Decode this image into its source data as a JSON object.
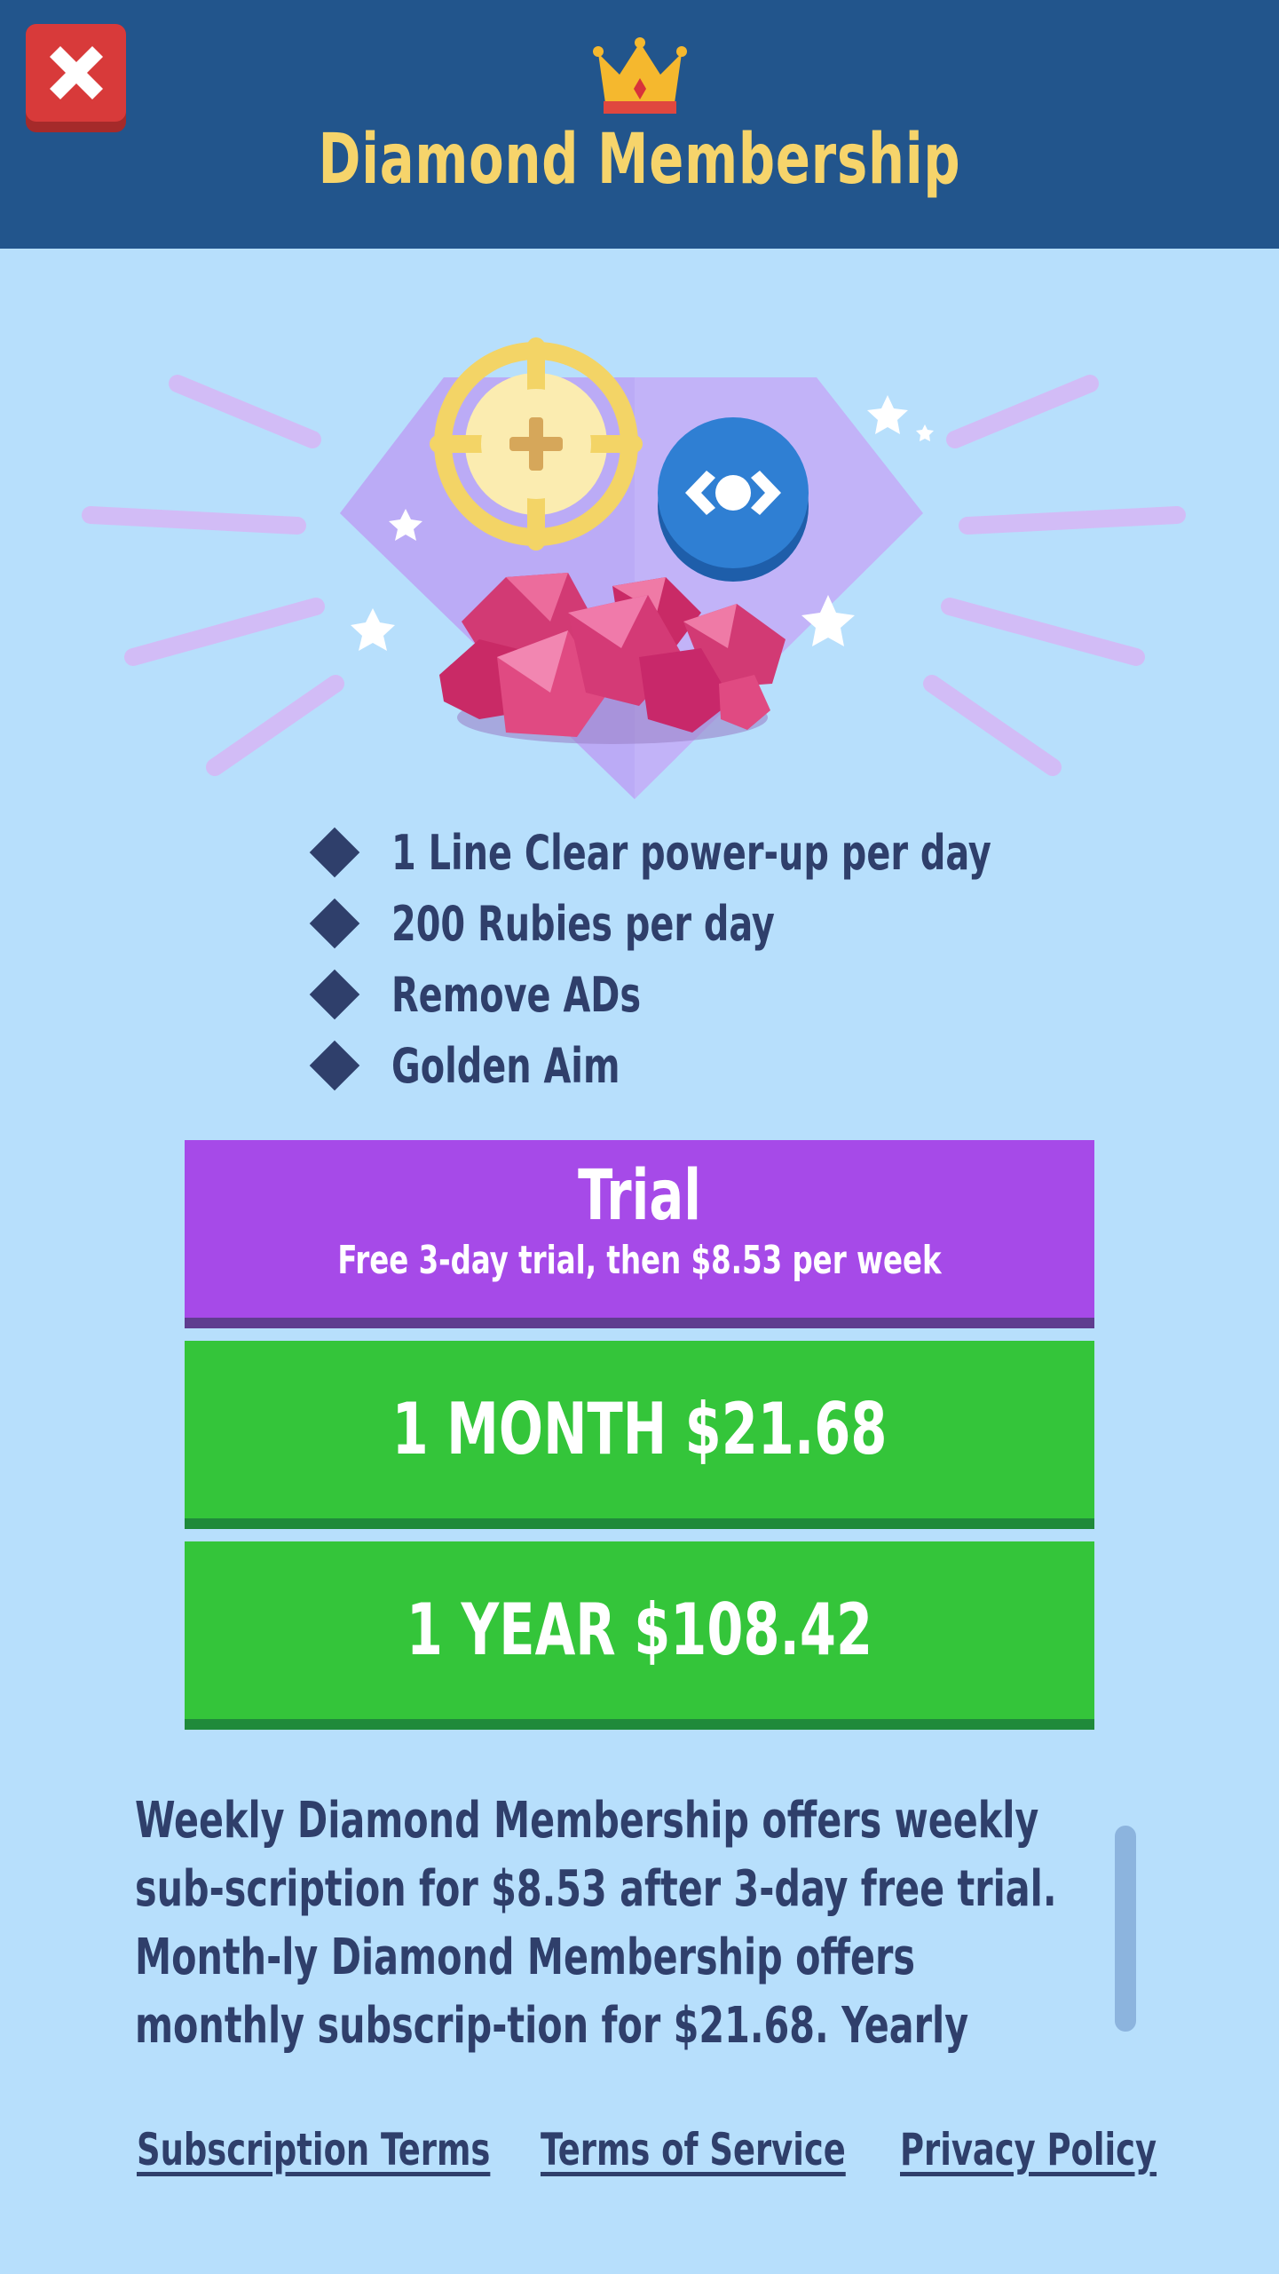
{
  "header": {
    "title": "Diamond Membership",
    "close_icon": "close-x-icon",
    "crown_icon": "crown-icon"
  },
  "hero": {
    "icons": [
      "golden-aim-icon",
      "line-clear-icon",
      "rubies-icon",
      "diamond-icon",
      "sparkle-star-icon"
    ]
  },
  "features": [
    "1 Line Clear power-up per day",
    "200 Rubies per day",
    "Remove ADs",
    "Golden Aim"
  ],
  "plans": {
    "trial": {
      "title": "Trial",
      "subtitle": "Free 3-day trial, then $8.53 per week"
    },
    "month": {
      "label": "1 MONTH $21.68"
    },
    "year": {
      "label": "1 YEAR $108.42"
    }
  },
  "description": "Weekly Diamond Membership offers weekly sub-scription for $8.53 after 3-day free trial. Month-ly Diamond Membership offers monthly subscrip-tion for $21.68. Yearly Diamond Membership",
  "footer": {
    "subscription_terms": "Subscription Terms",
    "terms_of_service": "Terms of Service",
    "privacy_policy": "Privacy Policy"
  },
  "colors": {
    "header_bg": "#22558c",
    "page_bg": "#b7dffc",
    "title": "#f6d46b",
    "trial": "#a64ae8",
    "paid": "#34c53a",
    "text": "#2f3f6b",
    "close": "#d83a3a"
  }
}
